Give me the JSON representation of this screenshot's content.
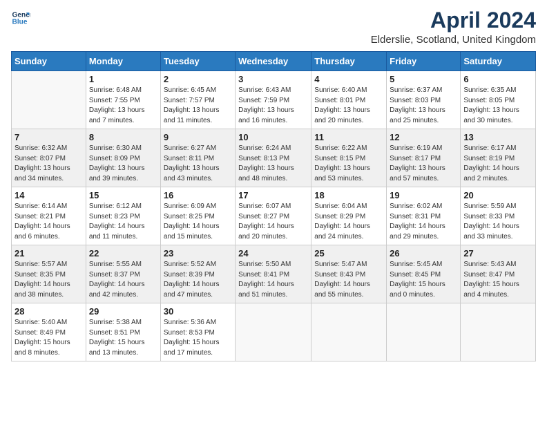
{
  "header": {
    "logo_line1": "General",
    "logo_line2": "Blue",
    "title": "April 2024",
    "subtitle": "Elderslie, Scotland, United Kingdom"
  },
  "days_of_week": [
    "Sunday",
    "Monday",
    "Tuesday",
    "Wednesday",
    "Thursday",
    "Friday",
    "Saturday"
  ],
  "weeks": [
    [
      {
        "num": "",
        "info": ""
      },
      {
        "num": "1",
        "info": "Sunrise: 6:48 AM\nSunset: 7:55 PM\nDaylight: 13 hours\nand 7 minutes."
      },
      {
        "num": "2",
        "info": "Sunrise: 6:45 AM\nSunset: 7:57 PM\nDaylight: 13 hours\nand 11 minutes."
      },
      {
        "num": "3",
        "info": "Sunrise: 6:43 AM\nSunset: 7:59 PM\nDaylight: 13 hours\nand 16 minutes."
      },
      {
        "num": "4",
        "info": "Sunrise: 6:40 AM\nSunset: 8:01 PM\nDaylight: 13 hours\nand 20 minutes."
      },
      {
        "num": "5",
        "info": "Sunrise: 6:37 AM\nSunset: 8:03 PM\nDaylight: 13 hours\nand 25 minutes."
      },
      {
        "num": "6",
        "info": "Sunrise: 6:35 AM\nSunset: 8:05 PM\nDaylight: 13 hours\nand 30 minutes."
      }
    ],
    [
      {
        "num": "7",
        "info": "Sunrise: 6:32 AM\nSunset: 8:07 PM\nDaylight: 13 hours\nand 34 minutes."
      },
      {
        "num": "8",
        "info": "Sunrise: 6:30 AM\nSunset: 8:09 PM\nDaylight: 13 hours\nand 39 minutes."
      },
      {
        "num": "9",
        "info": "Sunrise: 6:27 AM\nSunset: 8:11 PM\nDaylight: 13 hours\nand 43 minutes."
      },
      {
        "num": "10",
        "info": "Sunrise: 6:24 AM\nSunset: 8:13 PM\nDaylight: 13 hours\nand 48 minutes."
      },
      {
        "num": "11",
        "info": "Sunrise: 6:22 AM\nSunset: 8:15 PM\nDaylight: 13 hours\nand 53 minutes."
      },
      {
        "num": "12",
        "info": "Sunrise: 6:19 AM\nSunset: 8:17 PM\nDaylight: 13 hours\nand 57 minutes."
      },
      {
        "num": "13",
        "info": "Sunrise: 6:17 AM\nSunset: 8:19 PM\nDaylight: 14 hours\nand 2 minutes."
      }
    ],
    [
      {
        "num": "14",
        "info": "Sunrise: 6:14 AM\nSunset: 8:21 PM\nDaylight: 14 hours\nand 6 minutes."
      },
      {
        "num": "15",
        "info": "Sunrise: 6:12 AM\nSunset: 8:23 PM\nDaylight: 14 hours\nand 11 minutes."
      },
      {
        "num": "16",
        "info": "Sunrise: 6:09 AM\nSunset: 8:25 PM\nDaylight: 14 hours\nand 15 minutes."
      },
      {
        "num": "17",
        "info": "Sunrise: 6:07 AM\nSunset: 8:27 PM\nDaylight: 14 hours\nand 20 minutes."
      },
      {
        "num": "18",
        "info": "Sunrise: 6:04 AM\nSunset: 8:29 PM\nDaylight: 14 hours\nand 24 minutes."
      },
      {
        "num": "19",
        "info": "Sunrise: 6:02 AM\nSunset: 8:31 PM\nDaylight: 14 hours\nand 29 minutes."
      },
      {
        "num": "20",
        "info": "Sunrise: 5:59 AM\nSunset: 8:33 PM\nDaylight: 14 hours\nand 33 minutes."
      }
    ],
    [
      {
        "num": "21",
        "info": "Sunrise: 5:57 AM\nSunset: 8:35 PM\nDaylight: 14 hours\nand 38 minutes."
      },
      {
        "num": "22",
        "info": "Sunrise: 5:55 AM\nSunset: 8:37 PM\nDaylight: 14 hours\nand 42 minutes."
      },
      {
        "num": "23",
        "info": "Sunrise: 5:52 AM\nSunset: 8:39 PM\nDaylight: 14 hours\nand 47 minutes."
      },
      {
        "num": "24",
        "info": "Sunrise: 5:50 AM\nSunset: 8:41 PM\nDaylight: 14 hours\nand 51 minutes."
      },
      {
        "num": "25",
        "info": "Sunrise: 5:47 AM\nSunset: 8:43 PM\nDaylight: 14 hours\nand 55 minutes."
      },
      {
        "num": "26",
        "info": "Sunrise: 5:45 AM\nSunset: 8:45 PM\nDaylight: 15 hours\nand 0 minutes."
      },
      {
        "num": "27",
        "info": "Sunrise: 5:43 AM\nSunset: 8:47 PM\nDaylight: 15 hours\nand 4 minutes."
      }
    ],
    [
      {
        "num": "28",
        "info": "Sunrise: 5:40 AM\nSunset: 8:49 PM\nDaylight: 15 hours\nand 8 minutes."
      },
      {
        "num": "29",
        "info": "Sunrise: 5:38 AM\nSunset: 8:51 PM\nDaylight: 15 hours\nand 13 minutes."
      },
      {
        "num": "30",
        "info": "Sunrise: 5:36 AM\nSunset: 8:53 PM\nDaylight: 15 hours\nand 17 minutes."
      },
      {
        "num": "",
        "info": ""
      },
      {
        "num": "",
        "info": ""
      },
      {
        "num": "",
        "info": ""
      },
      {
        "num": "",
        "info": ""
      }
    ]
  ],
  "shaded_rows": [
    1,
    3
  ]
}
